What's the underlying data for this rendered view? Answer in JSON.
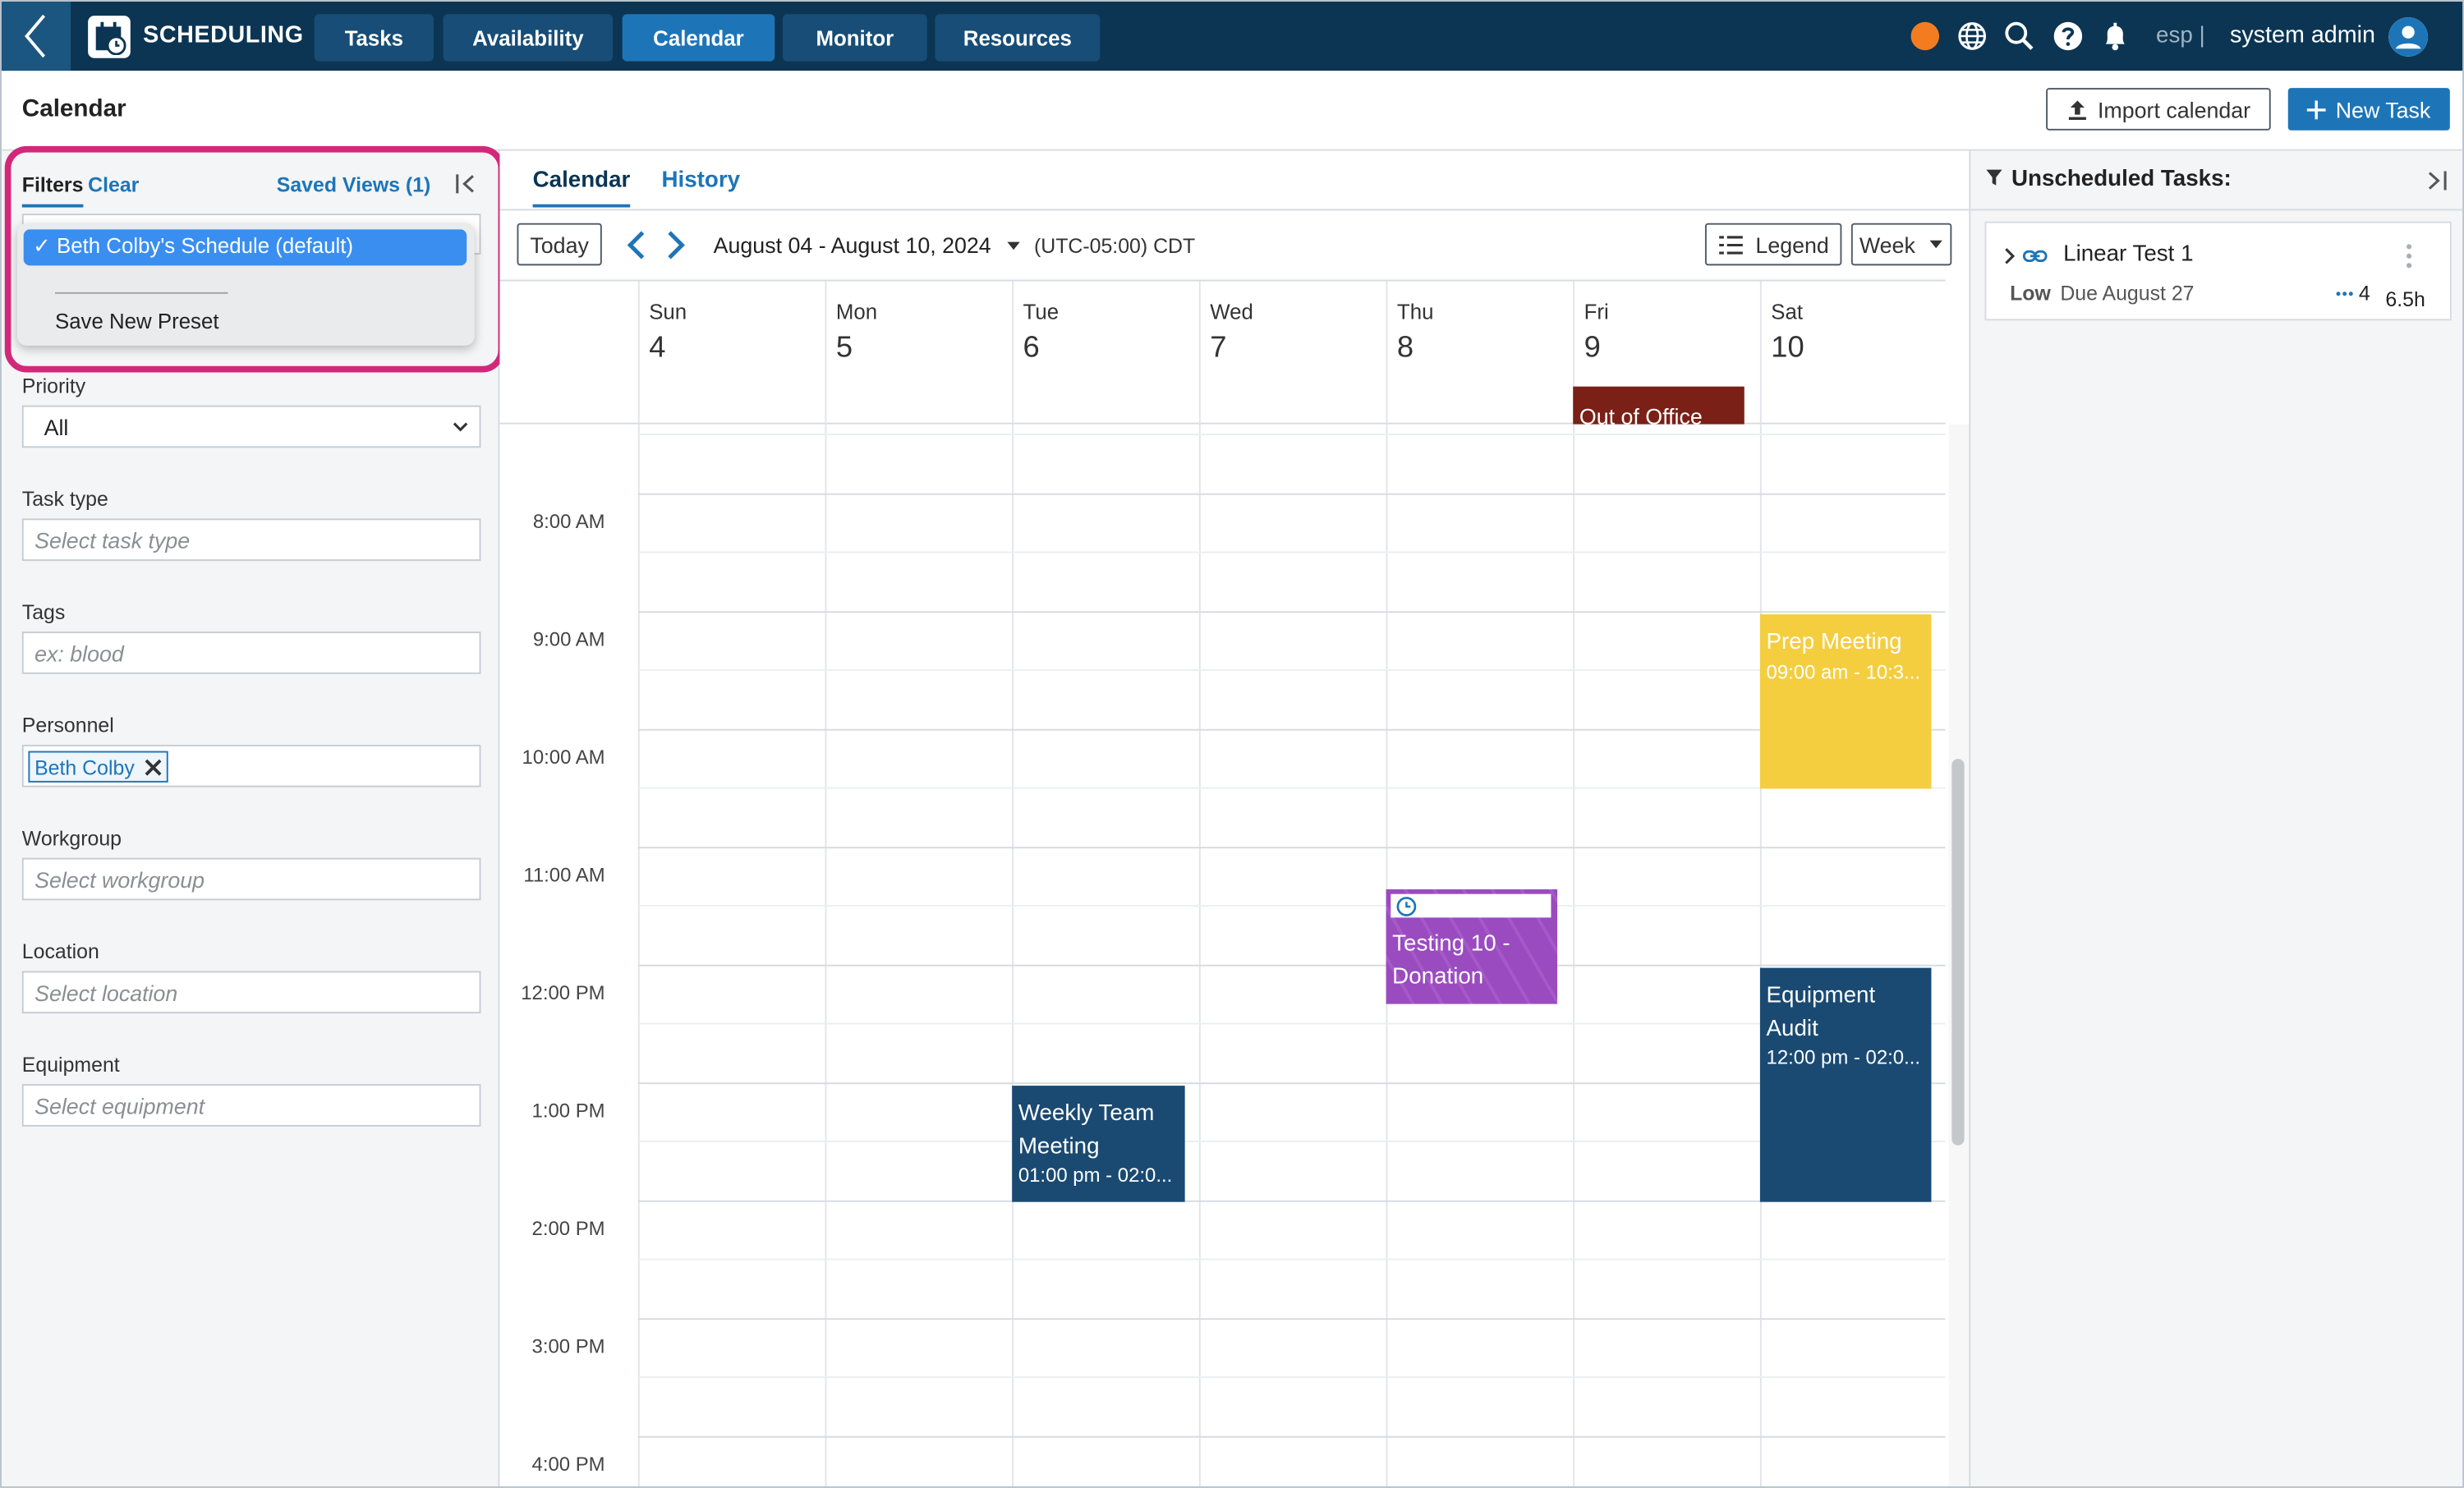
{
  "colors": {
    "topbar": "#0b3553",
    "nav_button": "#174d76",
    "nav_active": "#1d75b8",
    "accent": "#1d75b8",
    "highlight_border": "#d2287a",
    "event_navy": "#1a4a72",
    "event_yellow": "#f4ce3f",
    "event_purple": "#9a4bc0",
    "event_out_of_office": "#7a2016",
    "notification_dot": "#f47c20"
  },
  "topbar": {
    "app_name": "SCHEDULING",
    "back_icon": "chevron-left-icon",
    "app_icon": "calendar-clock-icon",
    "nav": [
      {
        "label": "Tasks",
        "active": false
      },
      {
        "label": "Availability",
        "active": false
      },
      {
        "label": "Calendar",
        "active": true
      },
      {
        "label": "Monitor",
        "active": false
      },
      {
        "label": "Resources",
        "active": false
      }
    ],
    "icons": [
      "status-dot-icon",
      "globe-icon",
      "search-icon",
      "help-icon",
      "bell-icon"
    ],
    "language": "esp |",
    "user_name": "system admin",
    "avatar_icon": "user-avatar-icon"
  },
  "header": {
    "title": "Calendar",
    "import_label": "Import calendar",
    "new_task_label": "New Task"
  },
  "filters": {
    "tab_label": "Filters",
    "clear_label": "Clear",
    "saved_views_label": "Saved Views (1)",
    "dropdown": {
      "selected_option": "✓ Beth Colby's Schedule (default)",
      "save_preset_label": "Save New Preset"
    },
    "priority": {
      "label": "Priority",
      "value": "All"
    },
    "task_type": {
      "label": "Task type",
      "placeholder": "Select task type"
    },
    "tags": {
      "label": "Tags",
      "placeholder": "ex: blood"
    },
    "personnel": {
      "label": "Personnel",
      "tag": "Beth Colby"
    },
    "workgroup": {
      "label": "Workgroup",
      "placeholder": "Select workgroup"
    },
    "location": {
      "label": "Location",
      "placeholder": "Select location"
    },
    "equipment": {
      "label": "Equipment",
      "placeholder": "Select equipment"
    }
  },
  "calendar": {
    "tabs": [
      {
        "label": "Calendar",
        "active": true
      },
      {
        "label": "History",
        "active": false
      }
    ],
    "today_label": "Today",
    "date_range": "August 04 - August 10, 2024",
    "timezone": "(UTC-05:00) CDT",
    "legend_label": "Legend",
    "view_label": "Week",
    "days": [
      {
        "name": "Sun",
        "num": "4"
      },
      {
        "name": "Mon",
        "num": "5"
      },
      {
        "name": "Tue",
        "num": "6"
      },
      {
        "name": "Wed",
        "num": "7"
      },
      {
        "name": "Thu",
        "num": "8"
      },
      {
        "name": "Fri",
        "num": "9"
      },
      {
        "name": "Sat",
        "num": "10"
      }
    ],
    "time_labels": [
      "8:00 AM",
      "9:00 AM",
      "10:00 AM",
      "11:00 AM",
      "12:00 PM",
      "1:00 PM",
      "2:00 PM",
      "3:00 PM",
      "4:00 PM"
    ],
    "all_day_event": {
      "title": "Out of Office",
      "day": "Fri"
    },
    "events": [
      {
        "key": "prep",
        "title": "Prep Meeting",
        "time": "09:00 am - 10:3..."
      },
      {
        "key": "testing",
        "title": "Testing 10 - Donation",
        "time": ""
      },
      {
        "key": "audit",
        "title": "Equipment Audit",
        "time": "12:00 pm - 02:0..."
      },
      {
        "key": "weekly",
        "title": "Weekly Team Meeting",
        "time": "01:00 pm - 02:0..."
      }
    ]
  },
  "unscheduled": {
    "title": "Unscheduled Tasks:",
    "tasks": [
      {
        "name": "Linear Test 1",
        "priority": "Low",
        "due": "Due August 27",
        "count": "4",
        "duration": "6.5h"
      }
    ]
  }
}
